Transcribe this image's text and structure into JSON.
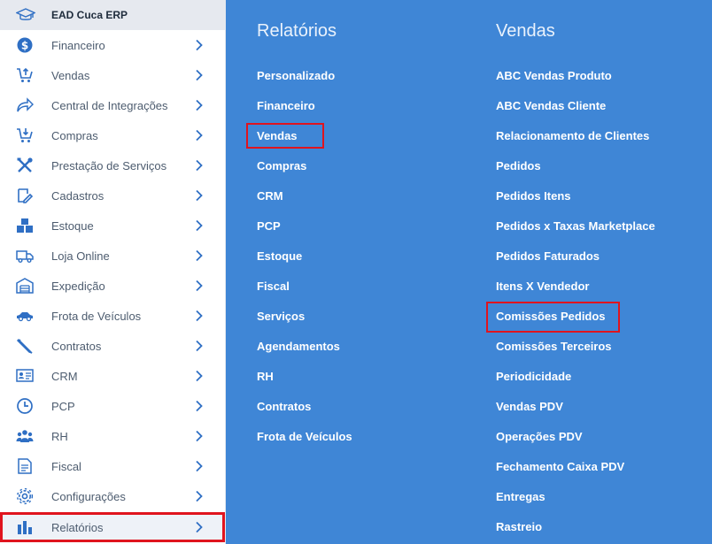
{
  "brand": {
    "name": "EAD Cuca ERP",
    "icon": "graduation-cap-icon"
  },
  "sidebar": {
    "items": [
      {
        "label": "Financeiro",
        "icon": "dollar-circle-icon"
      },
      {
        "label": "Vendas",
        "icon": "cart-up-icon"
      },
      {
        "label": "Central de Integrações",
        "icon": "share-arrow-icon"
      },
      {
        "label": "Compras",
        "icon": "cart-down-icon"
      },
      {
        "label": "Prestação de Serviços",
        "icon": "tools-icon"
      },
      {
        "label": "Cadastros",
        "icon": "edit-note-icon"
      },
      {
        "label": "Estoque",
        "icon": "boxes-icon"
      },
      {
        "label": "Loja Online",
        "icon": "truck-icon"
      },
      {
        "label": "Expedição",
        "icon": "warehouse-icon"
      },
      {
        "label": "Frota de Veículos",
        "icon": "car-icon"
      },
      {
        "label": "Contratos",
        "icon": "pencil-icon"
      },
      {
        "label": "CRM",
        "icon": "id-card-icon"
      },
      {
        "label": "PCP",
        "icon": "clock-icon"
      },
      {
        "label": "RH",
        "icon": "people-icon"
      },
      {
        "label": "Fiscal",
        "icon": "document-icon"
      },
      {
        "label": "Configurações",
        "icon": "gear-icon"
      },
      {
        "label": "Relatórios",
        "icon": "bar-chart-icon"
      }
    ]
  },
  "panel": {
    "col1": {
      "title": "Relatórios",
      "links": [
        "Personalizado",
        "Financeiro",
        "Vendas",
        "Compras",
        "CRM",
        "PCP",
        "Estoque",
        "Fiscal",
        "Serviços",
        "Agendamentos",
        "RH",
        "Contratos",
        "Frota de Veículos"
      ]
    },
    "col2": {
      "title": "Vendas",
      "links": [
        "ABC Vendas Produto",
        "ABC Vendas Cliente",
        "Relacionamento de Clientes",
        "Pedidos",
        "Pedidos Itens",
        "Pedidos x Taxas Marketplace",
        "Pedidos Faturados",
        "Itens X Vendedor",
        "Comissões Pedidos",
        "Comissões Terceiros",
        "Periodicidade",
        "Vendas PDV",
        "Operações PDV",
        "Fechamento Caixa PDV",
        "Entregas",
        "Rastreio"
      ]
    }
  },
  "colors": {
    "panel_bg": "#3f86d6",
    "icon_blue": "#2f6fc4",
    "highlight": "#e0141e"
  }
}
